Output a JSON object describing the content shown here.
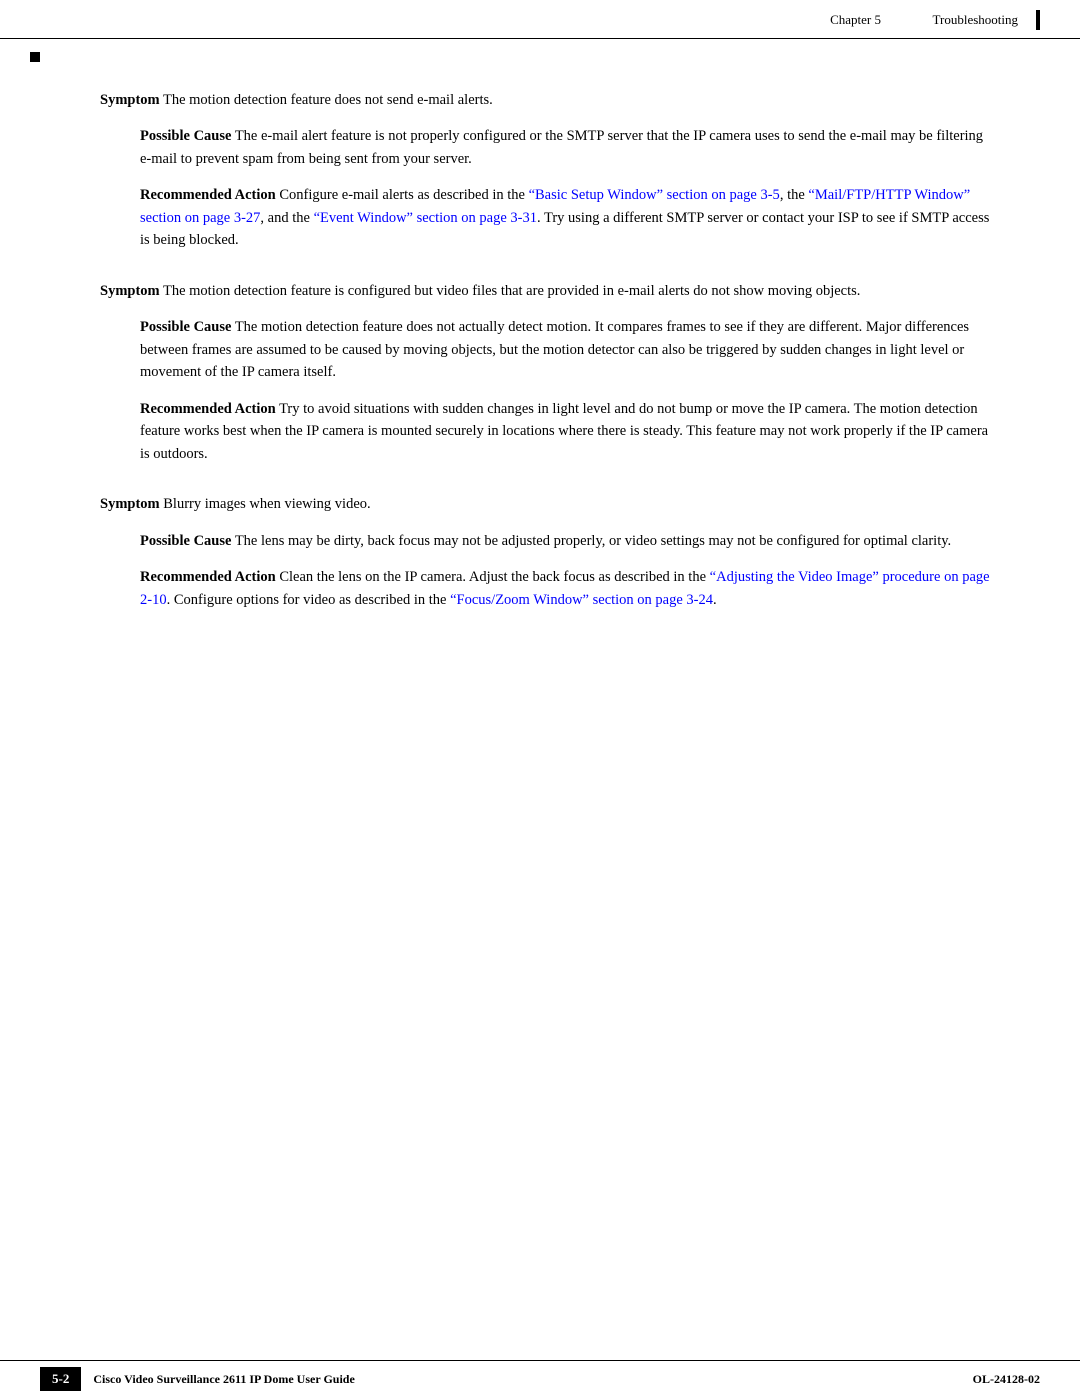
{
  "header": {
    "chapter": "Chapter 5",
    "title": "Troubleshooting"
  },
  "content": {
    "symptom1": {
      "label": "Symptom",
      "text": "  The motion detection feature does not send e-mail alerts."
    },
    "symptom1_possible_cause": {
      "label": "Possible Cause",
      "text": "  The e-mail alert feature is not properly configured or the SMTP server that the IP camera uses to send the e-mail may be filtering e-mail to prevent spam from being sent from your server."
    },
    "symptom1_recommended_action": {
      "label": "Recommended Action",
      "text_before": "  Configure e-mail alerts as described in the ",
      "link1_text": "“Basic Setup Window” section on page 3-5",
      "text_between1": ", the ",
      "link2_text": "“Mail/FTP/HTTP Window” section on page 3-27",
      "text_between2": ", and the ",
      "link3_text": "“Event Window” section on page 3-31",
      "text_after": ". Try using a different SMTP server or contact your ISP to see if SMTP access is being blocked."
    },
    "symptom2": {
      "label": "Symptom",
      "text": "  The motion detection feature is configured but video files that are provided in e-mail alerts do not show moving objects."
    },
    "symptom2_possible_cause": {
      "label": "Possible Cause",
      "text": "  The motion detection feature does not actually detect motion. It compares frames to see if they are different. Major differences between frames are assumed to be caused by moving objects, but the motion detector can also be triggered by sudden changes in light level or movement of the IP camera itself."
    },
    "symptom2_recommended_action": {
      "label": "Recommended Action",
      "text": "  Try to avoid situations with sudden changes in light level and do not bump or move the IP camera. The motion detection feature works best when the IP camera is mounted securely in locations where there is steady. This feature may not work properly if the IP camera is outdoors."
    },
    "symptom3": {
      "label": "Symptom",
      "text": "  Blurry images when viewing video."
    },
    "symptom3_possible_cause": {
      "label": "Possible Cause",
      "text": "  The lens may be dirty, back focus may not be adjusted properly, or video settings may not be configured for optimal clarity."
    },
    "symptom3_recommended_action": {
      "label": "Recommended Action",
      "text_before": "  Clean the lens on the IP camera. Adjust the back focus as described in the ",
      "link1_text": "“Adjusting the Video Image” procedure on page 2-10",
      "text_between": ". Configure options for video as described in the ",
      "link2_text": "“Focus/Zoom Window” section on page 3-24",
      "text_after": "."
    }
  },
  "footer": {
    "page_number": "5-2",
    "document_title": "Cisco Video Surveillance 2611 IP Dome User Guide",
    "doc_number": "OL-24128-02"
  }
}
